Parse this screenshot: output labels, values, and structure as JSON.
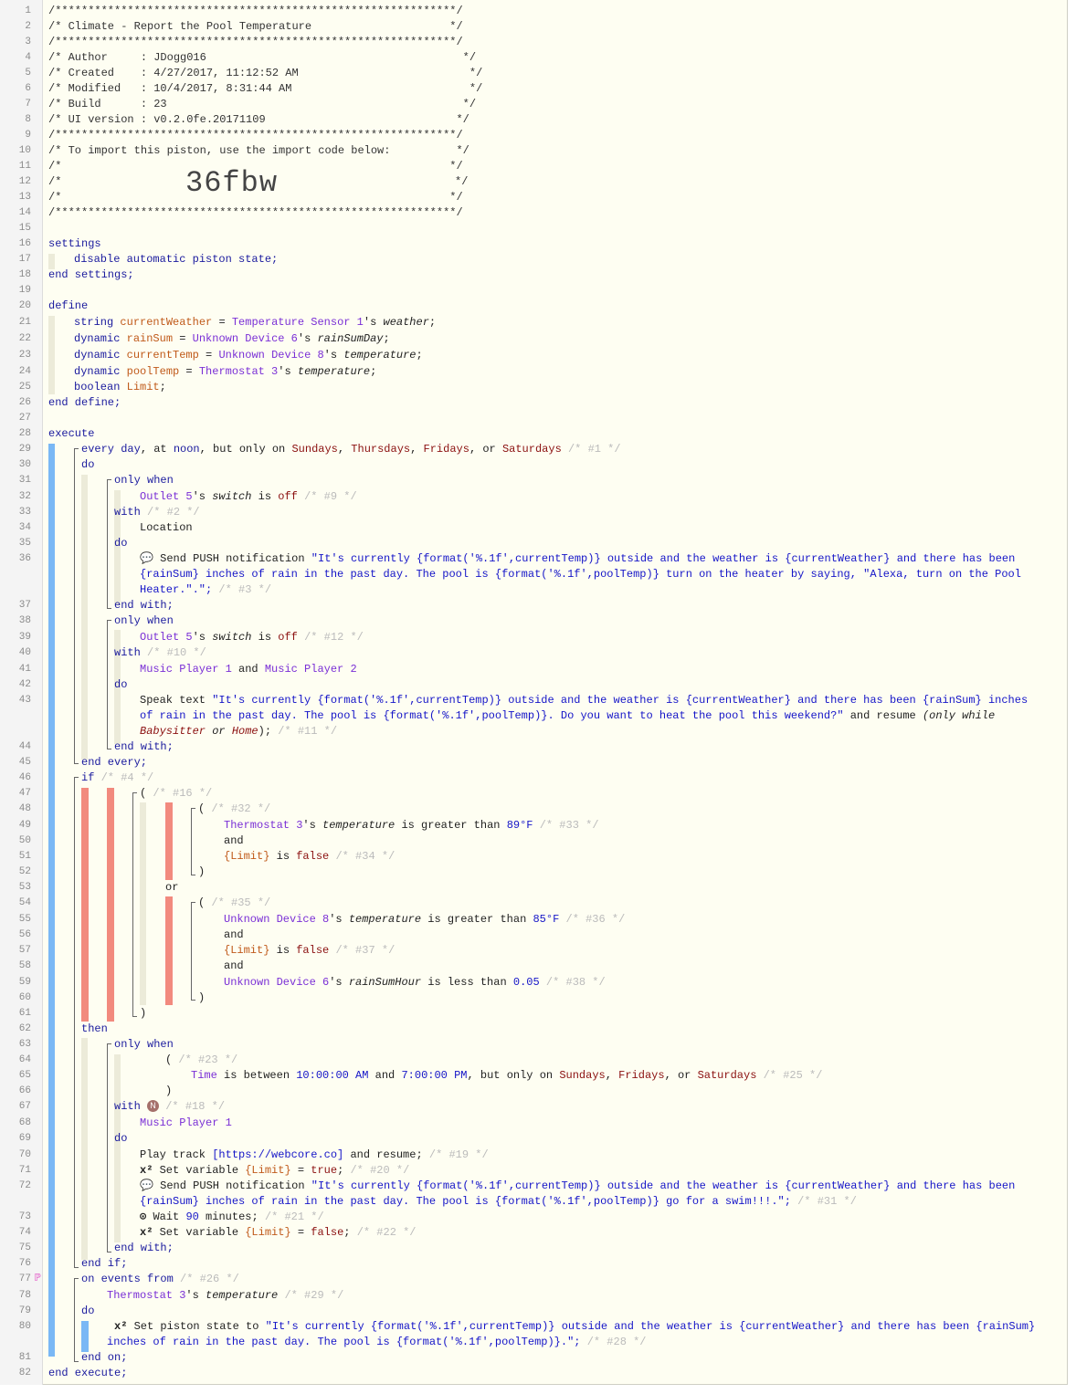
{
  "header": {
    "stars": "/*************************************************************/",
    "title": "/* Climate - Report the Pool Temperature                     */",
    "author": "/* Author     : JDogg016                                       */",
    "created": "/* Created    : 4/27/2017, 11:12:52 AM                          */",
    "modified": "/* Modified   : 10/4/2017, 8:31:44 AM                           */",
    "build": "/* Build      : 23                                             */",
    "ui_version": "/* UI version : v0.2.0fe.20171109                             */",
    "import_note": "/* To import this piston, use the import code below:          */",
    "blank": "/*                                                           */",
    "blank_left": "/*",
    "blank_right": "*/",
    "import_code": "36fbw"
  },
  "settings": {
    "open": "settings",
    "item": "disable automatic piston state;",
    "close": "end settings;"
  },
  "define": {
    "open": "define",
    "close": "end define;",
    "v1_type": "string",
    "v1_name": "currentWeather",
    "v1_dev": "Temperature Sensor 1",
    "v1_attr": "weather",
    "v2_type": "dynamic",
    "v2_name": "rainSum",
    "v2_dev": "Unknown Device 6",
    "v2_attr": "rainSumDay",
    "v3_type": "dynamic",
    "v3_name": "currentTemp",
    "v3_dev": "Unknown Device 8",
    "v3_attr": "temperature",
    "v4_type": "dynamic",
    "v4_name": "poolTemp",
    "v4_dev": "Thermostat 3",
    "v4_attr": "temperature",
    "v5_type": "boolean",
    "v5_name": "Limit"
  },
  "execute": {
    "open": "execute",
    "close": "end execute;",
    "every_day": "every day",
    "at_noon": "noon",
    "days1": [
      "Sundays",
      "Thursdays",
      "Fridays",
      "Saturdays"
    ],
    "c1": "/* #1 */",
    "do": "do",
    "only_when": "only when",
    "with": "with",
    "end_with": "end with;",
    "end_every": "end every;",
    "outlet": "Outlet 5",
    "switch": "switch",
    "off": "off",
    "c9": "/* #9 */",
    "c2": "/* #2 */",
    "location": "Location",
    "push_icon": "💬",
    "push1_a": "Send PUSH notification ",
    "push1_b": "\"It's currently {format('%.1f',currentTemp)} outside and the weather is {currentWeather} and there has been",
    "push1_c": "{rainSum} inches of rain in the past day. The pool is {format('%.1f',poolTemp)} turn on the heater by saying, \"Alexa, turn on the Pool",
    "push1_d": "Heater.\".\";",
    "c3": "/* #3 */",
    "c12": "/* #12 */",
    "c10": "/* #10 */",
    "mp1": "Music Player 1",
    "mp2": "Music Player 2",
    "and": "and",
    "or": "or",
    "speak_a": "Speak text ",
    "speak_b": "\"It's currently {format('%.1f',currentTemp)} outside and the weather is {currentWeather} and there has been {rainSum} inches",
    "speak_c": "of rain in the past day. The pool is {format('%.1f',poolTemp)}. Do you want to heat the pool this weekend?\"",
    "speak_d": " and resume ",
    "speak_e": "(only while",
    "babysitter": "Babysitter",
    "home": "Home",
    "c11": "/* #11 */",
    "if": "if",
    "c4": "/* #4 */",
    "c16": "/* #16 */",
    "c32": "/* #32 */",
    "thermo": "Thermostat 3",
    "temperature": "temperature",
    "greater_than": "is greater than",
    "t89": "89°F",
    "c33": "/* #33 */",
    "limit": "{Limit}",
    "is_false": "is",
    "false": "false",
    "c34": "/* #34 */",
    "c35": "/* #35 */",
    "ud8": "Unknown Device 8",
    "t85": "85°F",
    "c36": "/* #36 */",
    "c37": "/* #37 */",
    "ud6": "Unknown Device 6",
    "rainSumHour": "rainSumHour",
    "less_than": "is less than",
    "v005": "0.05",
    "c38": "/* #38 */",
    "then": "then",
    "c23": "/* #23 */",
    "time": "Time",
    "between": "is between",
    "t_from": "10:00:00 AM",
    "t_to": "7:00:00 PM",
    "days2": [
      "Sundays",
      "Fridays",
      "Saturdays"
    ],
    "c25": "/* #25 */",
    "badge": "N",
    "c18": "/* #18 */",
    "play_a": "Play track ",
    "play_url": "[https://webcore.co]",
    "play_b": " and resume;",
    "c19": "/* #19 */",
    "x2": "x²",
    "set_var": "Set variable ",
    "true": "true",
    "c20": "/* #20 */",
    "push2_b": "\"It's currently {format('%.1f',currentTemp)} outside and the weather is {currentWeather} and there has been",
    "push2_c": "{rainSum} inches of rain in the past day. The pool is {format('%.1f',poolTemp)} go for a swim!!!.\";",
    "c31": "/* #31 */",
    "wait_icon": "⊙",
    "wait": "Wait ",
    "wait_n": "90",
    "minutes": " minutes;",
    "c21": "/* #21 */",
    "c22": "/* #22 */",
    "end_if": "end if;",
    "on_events": "on events from",
    "c26": "/* #26 */",
    "c29": "/* #29 */",
    "set_state": "Set piston state to ",
    "state_b": "\"It's currently {format('%.1f',currentTemp)} outside and the weather is {currentWeather} and there has been {rainSum}",
    "state_c": "inches of rain in the past day. The pool is {format('%.1f',poolTemp)}.\";",
    "c28": "/* #28 */",
    "end_on": "end on;",
    "pin": "ℙ"
  },
  "colors": {
    "editor_bg": "#fefef2",
    "blue_bar": "#7ab8f5",
    "red_bar": "#f28a7e",
    "keyword": "#1a1a9e",
    "device": "#7a2fd6",
    "string": "#1515c8",
    "variable": "#c05a1a",
    "comment": "#bbbbbb"
  }
}
